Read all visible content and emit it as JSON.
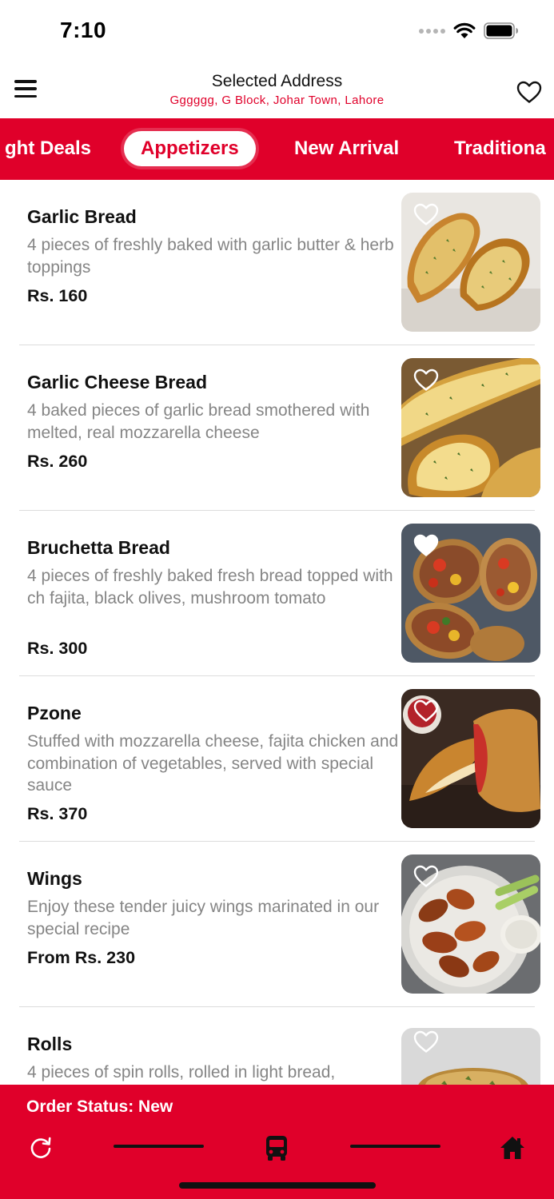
{
  "status_bar": {
    "time": "7:10"
  },
  "header": {
    "title": "Selected Address",
    "address": "Gggggg, G Block, Johar Town, Lahore"
  },
  "tabs": [
    {
      "label": "ght Deals",
      "active": false
    },
    {
      "label": "Appetizers",
      "active": true
    },
    {
      "label": "New Arrival",
      "active": false
    },
    {
      "label": "Traditiona",
      "active": false
    }
  ],
  "items": [
    {
      "name": "Garlic Bread",
      "description": "4 pieces of freshly baked with garlic butter & herb toppings",
      "price": "Rs. 160",
      "favorite": false,
      "image_icon": "garlic-bread-image"
    },
    {
      "name": "Garlic Cheese Bread",
      "description": "4 baked pieces of garlic bread smothered with melted, real mozzarella cheese",
      "price": "Rs. 260",
      "favorite": false,
      "image_icon": "garlic-cheese-bread-image"
    },
    {
      "name": "Bruchetta Bread",
      "description": "4 pieces of freshly baked fresh bread topped with ch fajita, black olives, mushroom tomato",
      "price": "Rs. 300",
      "favorite": true,
      "image_icon": "bruchetta-image"
    },
    {
      "name": "Pzone",
      "description": "Stuffed with mozzarella cheese, fajita chicken and combination of vegetables, served with special sauce",
      "price": "Rs. 370",
      "favorite": false,
      "image_icon": "pzone-image"
    },
    {
      "name": "Wings",
      "description": "Enjoy these tender juicy wings marinated in our special recipe",
      "price": "From Rs. 230",
      "favorite": false,
      "image_icon": "wings-image"
    },
    {
      "name": "Rolls",
      "description": "4 pieces of spin rolls, rolled in light bread,",
      "price": "",
      "favorite": false,
      "image_icon": "rolls-image"
    }
  ],
  "bottom_bar": {
    "order_status": "Order Status: New",
    "icons": [
      "refresh-icon",
      "bus-icon",
      "home-icon"
    ]
  },
  "colors": {
    "brand_red": "#e0002a",
    "text_gray": "#858585",
    "divider": "#dcdcdc"
  }
}
